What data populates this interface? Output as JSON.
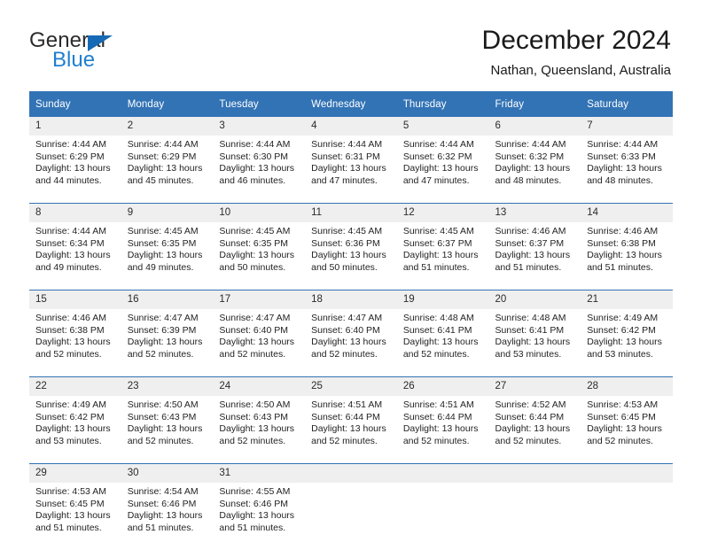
{
  "logo": {
    "text_primary": "General",
    "text_secondary": "Blue",
    "icon": "triangle-icon",
    "color_primary": "#2b2b2b",
    "color_secondary": "#1f7fd0",
    "color_triangle": "#1669b5"
  },
  "header": {
    "title": "December 2024",
    "subtitle": "Nathan, Queensland, Australia"
  },
  "theme": {
    "header_bg": "#3273b5",
    "header_text": "#ffffff",
    "daynum_bg": "#efefef",
    "cell_text": "#232323"
  },
  "calendar": {
    "weekday_headers": [
      "Sunday",
      "Monday",
      "Tuesday",
      "Wednesday",
      "Thursday",
      "Friday",
      "Saturday"
    ],
    "weeks": [
      {
        "days": [
          {
            "num": "1",
            "sunrise": "Sunrise: 4:44 AM",
            "sunset": "Sunset: 6:29 PM",
            "daylight_1": "Daylight: 13 hours",
            "daylight_2": "and 44 minutes."
          },
          {
            "num": "2",
            "sunrise": "Sunrise: 4:44 AM",
            "sunset": "Sunset: 6:29 PM",
            "daylight_1": "Daylight: 13 hours",
            "daylight_2": "and 45 minutes."
          },
          {
            "num": "3",
            "sunrise": "Sunrise: 4:44 AM",
            "sunset": "Sunset: 6:30 PM",
            "daylight_1": "Daylight: 13 hours",
            "daylight_2": "and 46 minutes."
          },
          {
            "num": "4",
            "sunrise": "Sunrise: 4:44 AM",
            "sunset": "Sunset: 6:31 PM",
            "daylight_1": "Daylight: 13 hours",
            "daylight_2": "and 47 minutes."
          },
          {
            "num": "5",
            "sunrise": "Sunrise: 4:44 AM",
            "sunset": "Sunset: 6:32 PM",
            "daylight_1": "Daylight: 13 hours",
            "daylight_2": "and 47 minutes."
          },
          {
            "num": "6",
            "sunrise": "Sunrise: 4:44 AM",
            "sunset": "Sunset: 6:32 PM",
            "daylight_1": "Daylight: 13 hours",
            "daylight_2": "and 48 minutes."
          },
          {
            "num": "7",
            "sunrise": "Sunrise: 4:44 AM",
            "sunset": "Sunset: 6:33 PM",
            "daylight_1": "Daylight: 13 hours",
            "daylight_2": "and 48 minutes."
          }
        ]
      },
      {
        "days": [
          {
            "num": "8",
            "sunrise": "Sunrise: 4:44 AM",
            "sunset": "Sunset: 6:34 PM",
            "daylight_1": "Daylight: 13 hours",
            "daylight_2": "and 49 minutes."
          },
          {
            "num": "9",
            "sunrise": "Sunrise: 4:45 AM",
            "sunset": "Sunset: 6:35 PM",
            "daylight_1": "Daylight: 13 hours",
            "daylight_2": "and 49 minutes."
          },
          {
            "num": "10",
            "sunrise": "Sunrise: 4:45 AM",
            "sunset": "Sunset: 6:35 PM",
            "daylight_1": "Daylight: 13 hours",
            "daylight_2": "and 50 minutes."
          },
          {
            "num": "11",
            "sunrise": "Sunrise: 4:45 AM",
            "sunset": "Sunset: 6:36 PM",
            "daylight_1": "Daylight: 13 hours",
            "daylight_2": "and 50 minutes."
          },
          {
            "num": "12",
            "sunrise": "Sunrise: 4:45 AM",
            "sunset": "Sunset: 6:37 PM",
            "daylight_1": "Daylight: 13 hours",
            "daylight_2": "and 51 minutes."
          },
          {
            "num": "13",
            "sunrise": "Sunrise: 4:46 AM",
            "sunset": "Sunset: 6:37 PM",
            "daylight_1": "Daylight: 13 hours",
            "daylight_2": "and 51 minutes."
          },
          {
            "num": "14",
            "sunrise": "Sunrise: 4:46 AM",
            "sunset": "Sunset: 6:38 PM",
            "daylight_1": "Daylight: 13 hours",
            "daylight_2": "and 51 minutes."
          }
        ]
      },
      {
        "days": [
          {
            "num": "15",
            "sunrise": "Sunrise: 4:46 AM",
            "sunset": "Sunset: 6:38 PM",
            "daylight_1": "Daylight: 13 hours",
            "daylight_2": "and 52 minutes."
          },
          {
            "num": "16",
            "sunrise": "Sunrise: 4:47 AM",
            "sunset": "Sunset: 6:39 PM",
            "daylight_1": "Daylight: 13 hours",
            "daylight_2": "and 52 minutes."
          },
          {
            "num": "17",
            "sunrise": "Sunrise: 4:47 AM",
            "sunset": "Sunset: 6:40 PM",
            "daylight_1": "Daylight: 13 hours",
            "daylight_2": "and 52 minutes."
          },
          {
            "num": "18",
            "sunrise": "Sunrise: 4:47 AM",
            "sunset": "Sunset: 6:40 PM",
            "daylight_1": "Daylight: 13 hours",
            "daylight_2": "and 52 minutes."
          },
          {
            "num": "19",
            "sunrise": "Sunrise: 4:48 AM",
            "sunset": "Sunset: 6:41 PM",
            "daylight_1": "Daylight: 13 hours",
            "daylight_2": "and 52 minutes."
          },
          {
            "num": "20",
            "sunrise": "Sunrise: 4:48 AM",
            "sunset": "Sunset: 6:41 PM",
            "daylight_1": "Daylight: 13 hours",
            "daylight_2": "and 53 minutes."
          },
          {
            "num": "21",
            "sunrise": "Sunrise: 4:49 AM",
            "sunset": "Sunset: 6:42 PM",
            "daylight_1": "Daylight: 13 hours",
            "daylight_2": "and 53 minutes."
          }
        ]
      },
      {
        "days": [
          {
            "num": "22",
            "sunrise": "Sunrise: 4:49 AM",
            "sunset": "Sunset: 6:42 PM",
            "daylight_1": "Daylight: 13 hours",
            "daylight_2": "and 53 minutes."
          },
          {
            "num": "23",
            "sunrise": "Sunrise: 4:50 AM",
            "sunset": "Sunset: 6:43 PM",
            "daylight_1": "Daylight: 13 hours",
            "daylight_2": "and 52 minutes."
          },
          {
            "num": "24",
            "sunrise": "Sunrise: 4:50 AM",
            "sunset": "Sunset: 6:43 PM",
            "daylight_1": "Daylight: 13 hours",
            "daylight_2": "and 52 minutes."
          },
          {
            "num": "25",
            "sunrise": "Sunrise: 4:51 AM",
            "sunset": "Sunset: 6:44 PM",
            "daylight_1": "Daylight: 13 hours",
            "daylight_2": "and 52 minutes."
          },
          {
            "num": "26",
            "sunrise": "Sunrise: 4:51 AM",
            "sunset": "Sunset: 6:44 PM",
            "daylight_1": "Daylight: 13 hours",
            "daylight_2": "and 52 minutes."
          },
          {
            "num": "27",
            "sunrise": "Sunrise: 4:52 AM",
            "sunset": "Sunset: 6:44 PM",
            "daylight_1": "Daylight: 13 hours",
            "daylight_2": "and 52 minutes."
          },
          {
            "num": "28",
            "sunrise": "Sunrise: 4:53 AM",
            "sunset": "Sunset: 6:45 PM",
            "daylight_1": "Daylight: 13 hours",
            "daylight_2": "and 52 minutes."
          }
        ]
      },
      {
        "days": [
          {
            "num": "29",
            "sunrise": "Sunrise: 4:53 AM",
            "sunset": "Sunset: 6:45 PM",
            "daylight_1": "Daylight: 13 hours",
            "daylight_2": "and 51 minutes."
          },
          {
            "num": "30",
            "sunrise": "Sunrise: 4:54 AM",
            "sunset": "Sunset: 6:46 PM",
            "daylight_1": "Daylight: 13 hours",
            "daylight_2": "and 51 minutes."
          },
          {
            "num": "31",
            "sunrise": "Sunrise: 4:55 AM",
            "sunset": "Sunset: 6:46 PM",
            "daylight_1": "Daylight: 13 hours",
            "daylight_2": "and 51 minutes."
          },
          {
            "num": "",
            "sunrise": "",
            "sunset": "",
            "daylight_1": "",
            "daylight_2": ""
          },
          {
            "num": "",
            "sunrise": "",
            "sunset": "",
            "daylight_1": "",
            "daylight_2": ""
          },
          {
            "num": "",
            "sunrise": "",
            "sunset": "",
            "daylight_1": "",
            "daylight_2": ""
          },
          {
            "num": "",
            "sunrise": "",
            "sunset": "",
            "daylight_1": "",
            "daylight_2": ""
          }
        ]
      }
    ]
  }
}
